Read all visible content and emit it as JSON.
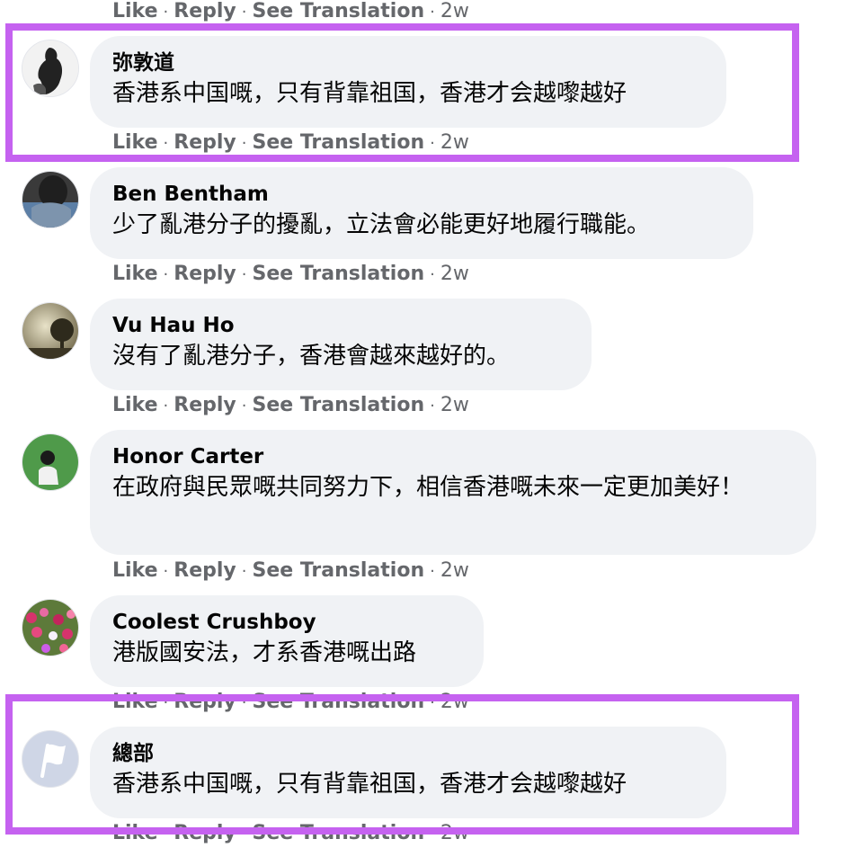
{
  "actions": {
    "like": "Like",
    "reply": "Reply",
    "see_translation": "See Translation",
    "separator": "·",
    "time": "2w"
  },
  "comments": [
    {
      "author": "弥敦道",
      "text": "香港系中国嘅，只有背靠祖国，香港才会越嚟越好",
      "avatar_icon": "silhouette-icon"
    },
    {
      "author": "Ben Bentham",
      "text": "少了亂港分子的擾亂，立法會必能更好地履行職能。",
      "avatar_icon": "person-photo-icon"
    },
    {
      "author": "Vu Hau Ho",
      "text": "沒有了亂港分子，香港會越來越好的。",
      "avatar_icon": "tree-photo-icon"
    },
    {
      "author": "Honor Carter",
      "text": "在政府與民眾嘅共同努力下，相信香港嘅未來一定更加美好！",
      "avatar_icon": "person-green-photo-icon"
    },
    {
      "author": "Coolest Crushboy",
      "text": "港版國安法，才系香港嘅出路",
      "avatar_icon": "flowers-photo-icon"
    },
    {
      "author": "總部",
      "text": "香港系中国嘅，只有背靠祖国，香港才会越嚟越好",
      "avatar_icon": "flag-icon"
    }
  ],
  "colors": {
    "highlight": "#c562f0",
    "bubble": "#f0f2f5",
    "meta_text": "#65676b"
  }
}
